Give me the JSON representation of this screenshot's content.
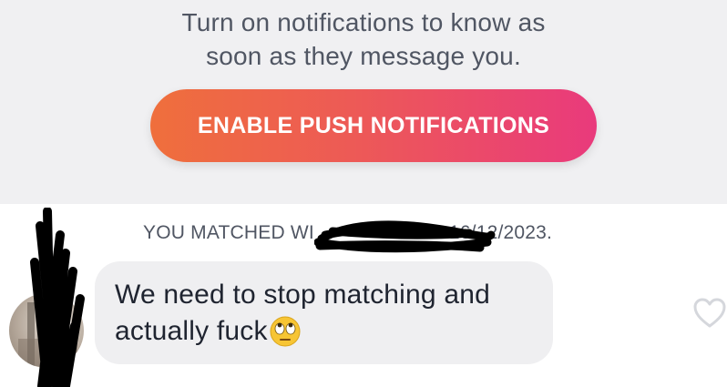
{
  "notification_prompt": {
    "line1": "Turn on notifications to know as",
    "line2": "soon as they message you.",
    "button_label": "ENABLE PUSH NOTIFICATIONS"
  },
  "match": {
    "prefix": "YOU MATCHED WI",
    "date": "16/12/2023."
  },
  "message": {
    "text": "We need to stop matching and actually fuck",
    "emoji_icon": "face-with-rolling-eyes-icon"
  },
  "icons": {
    "like": "heart-outline-icon"
  },
  "colors": {
    "button_gradient_start": "#ef6f3c",
    "button_gradient_end": "#e93a7c",
    "panel_background": "#f0f0f2",
    "bubble_background": "#efeff1",
    "secondary_text": "#505663"
  }
}
